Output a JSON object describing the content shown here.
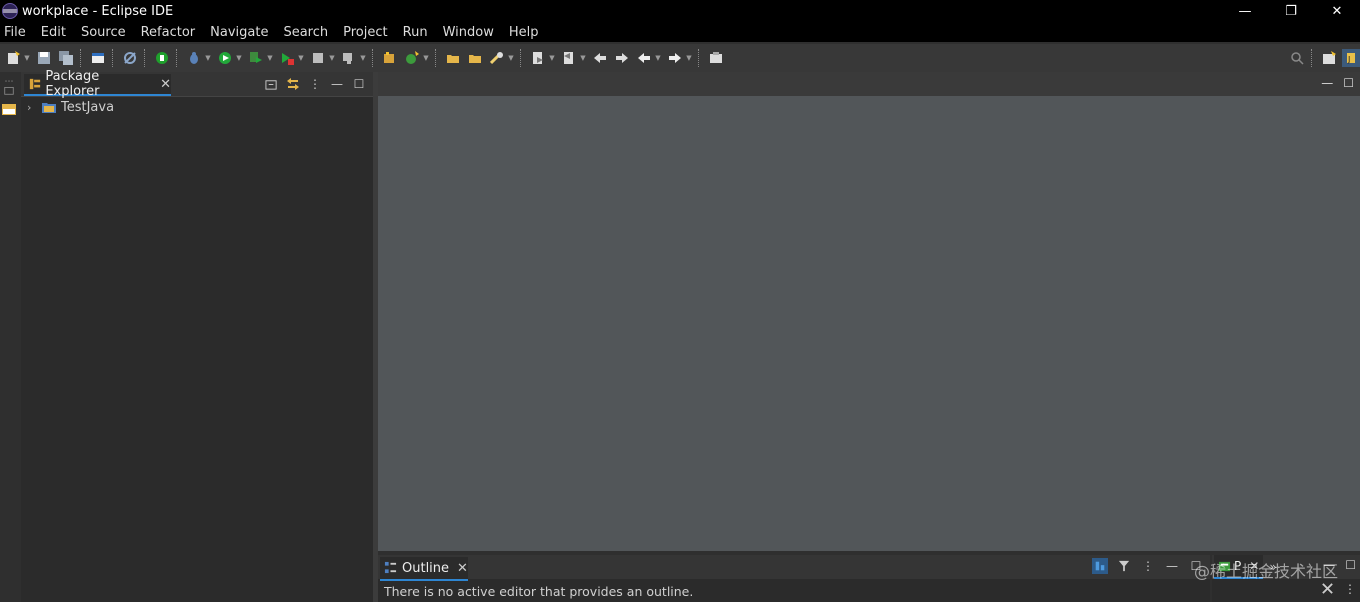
{
  "window": {
    "title": "workplace - Eclipse IDE",
    "minimize": "—",
    "restore": "❐",
    "close": "✕"
  },
  "menu": [
    "File",
    "Edit",
    "Source",
    "Refactor",
    "Navigate",
    "Search",
    "Project",
    "Run",
    "Window",
    "Help"
  ],
  "package_explorer": {
    "tab_label": "Package Explorer",
    "close": "✕",
    "tree": [
      {
        "label": "TestJava",
        "expanded": false
      }
    ]
  },
  "outline": {
    "tab_label": "Outline",
    "close": "✕",
    "message": "There is no active editor that provides an outline."
  },
  "right_panel": {
    "tab_label": "P",
    "close": "✕",
    "overflow": "»"
  },
  "watermark": "@稀土掘金技术社区",
  "colors": {
    "accent": "#2e86d3",
    "editor_bg": "#525659",
    "chrome_bg": "#000000"
  }
}
